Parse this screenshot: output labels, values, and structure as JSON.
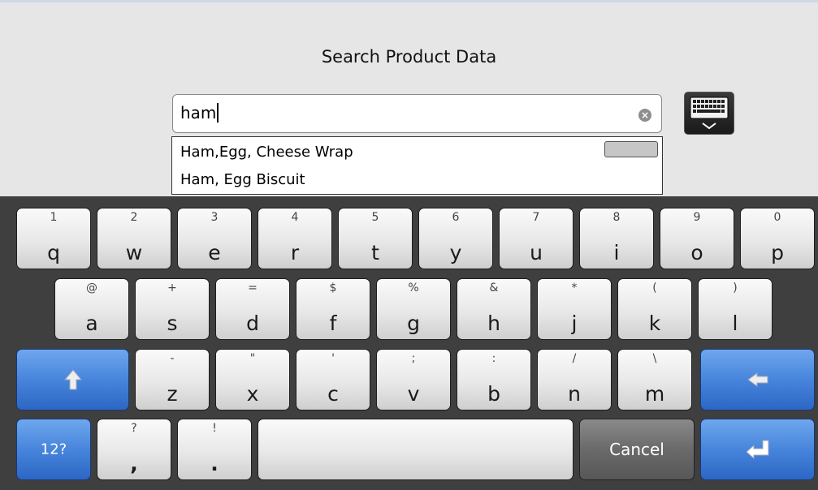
{
  "header": {
    "title": "Search Product Data"
  },
  "search": {
    "value": "ham"
  },
  "suggestions": [
    "Ham,Egg, Cheese Wrap",
    "Ham, Egg Biscuit"
  ],
  "keyboard": {
    "row1": [
      {
        "main": "q",
        "sub": "1"
      },
      {
        "main": "w",
        "sub": "2"
      },
      {
        "main": "e",
        "sub": "3"
      },
      {
        "main": "r",
        "sub": "4"
      },
      {
        "main": "t",
        "sub": "5"
      },
      {
        "main": "y",
        "sub": "6"
      },
      {
        "main": "u",
        "sub": "7"
      },
      {
        "main": "i",
        "sub": "8"
      },
      {
        "main": "o",
        "sub": "9"
      },
      {
        "main": "p",
        "sub": "0"
      }
    ],
    "row2": [
      {
        "main": "a",
        "sub": "@"
      },
      {
        "main": "s",
        "sub": "+"
      },
      {
        "main": "d",
        "sub": "="
      },
      {
        "main": "f",
        "sub": "$"
      },
      {
        "main": "g",
        "sub": "%"
      },
      {
        "main": "h",
        "sub": "&"
      },
      {
        "main": "j",
        "sub": "*"
      },
      {
        "main": "k",
        "sub": "("
      },
      {
        "main": "l",
        "sub": ")"
      }
    ],
    "row3": [
      {
        "main": "z",
        "sub": "-"
      },
      {
        "main": "x",
        "sub": "\""
      },
      {
        "main": "c",
        "sub": "'"
      },
      {
        "main": "v",
        "sub": ";"
      },
      {
        "main": "b",
        "sub": ":"
      },
      {
        "main": "n",
        "sub": "/"
      },
      {
        "main": "m",
        "sub": "\\"
      }
    ],
    "row4": [
      {
        "main": ",",
        "sub": "?"
      },
      {
        "main": ".",
        "sub": "!"
      }
    ],
    "mode_label": "12?",
    "cancel_label": "Cancel",
    "shift_icon": "shift-arrow-icon",
    "backspace_icon": "backspace-arrow-icon",
    "enter_icon": "enter-return-icon",
    "toggle_icon": "keyboard-hide-icon"
  },
  "colors": {
    "keyboard_bg": "#3f3f3f",
    "accent_blue": "#4785dc",
    "cancel_gray": "#6a6a6a",
    "page_bg": "#e6e6e6"
  }
}
